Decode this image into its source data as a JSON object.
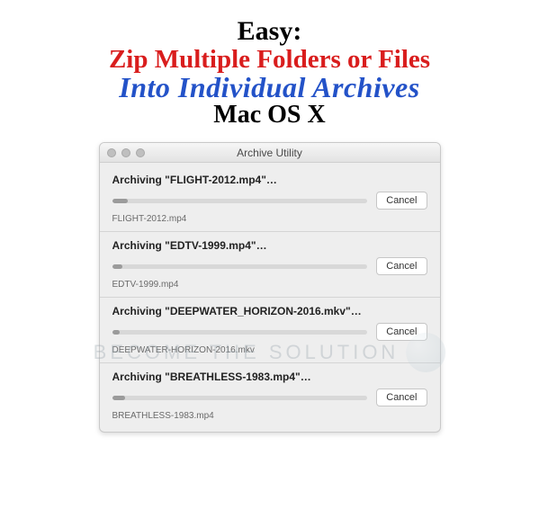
{
  "header": {
    "line1": "Easy:",
    "line2": "Zip Multiple Folders or Files",
    "line3": "Into Individual Archives",
    "line4": "Mac OS X"
  },
  "window": {
    "title": "Archive Utility"
  },
  "buttons": {
    "cancel": "Cancel"
  },
  "rows": [
    {
      "label": "Archiving \"FLIGHT-2012.mp4\"…",
      "filename": "FLIGHT-2012.mp4",
      "progress_pct": 6
    },
    {
      "label": "Archiving \"EDTV-1999.mp4\"…",
      "filename": "EDTV-1999.mp4",
      "progress_pct": 4
    },
    {
      "label": "Archiving \"DEEPWATER_HORIZON-2016.mkv\"…",
      "filename": "DEEPWATER-HORIZON-2016.mkv",
      "progress_pct": 3
    },
    {
      "label": "Archiving \"BREATHLESS-1983.mp4\"…",
      "filename": "BREATHLESS-1983.mp4",
      "progress_pct": 5
    }
  ],
  "watermark": {
    "text": "Become The Solution"
  }
}
